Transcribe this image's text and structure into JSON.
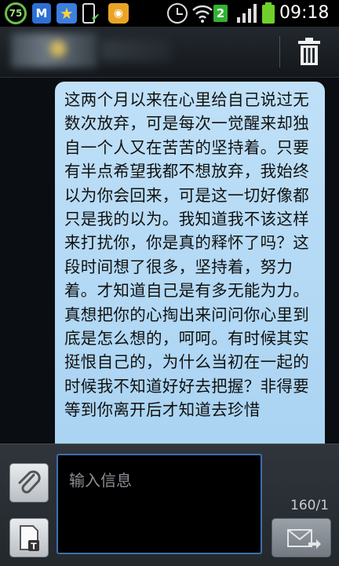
{
  "status_bar": {
    "battery_indicator_text": "75",
    "sim_indicator": "2",
    "time": "09:18",
    "icons": [
      "battery-level-icon",
      "app-notification-icon",
      "favorite-star-icon",
      "phone-icon",
      "check-icon",
      "shopping-bag-icon",
      "alarm-icon",
      "wifi-icon",
      "signal-icon",
      "battery-icon"
    ]
  },
  "header": {
    "contact_name": "",
    "delete_icon": "trash-icon"
  },
  "message": {
    "text": "这两个月以来在心里给自己说过无数次放弃，可是每次一觉醒来却独自一个人又在苦苦的坚持着。只要有半点希望我都不想放弃，我始终以为你会回来，可是这一切好像都只是我的以为。我知道我不该这样来打扰你，你是真的释怀了吗？这段时间想了很多，坚持着，努力着。才知道自己是有多无能为力。真想把你的心掏出来问问你心里到底是怎么想的，呵呵。有时候其实挺恨自己的，为什么当初在一起的时候我不知道好好去把握？非得要等到你离开后才知道去珍惜"
  },
  "compose": {
    "placeholder": "输入信息",
    "counter": "160/1",
    "attach_icon": "paperclip-icon",
    "template_icon": "text-template-icon",
    "send_icon": "send-envelope-icon"
  },
  "colors": {
    "bubble": "#b4d9f5",
    "background": "#0a0d11",
    "accent_border": "#3d6fae"
  }
}
